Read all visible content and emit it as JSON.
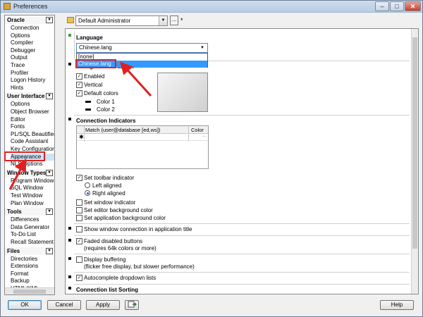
{
  "window": {
    "title": "Preferences",
    "min_glyph": "–",
    "max_glyph": "□",
    "close_glyph": "✕"
  },
  "nav": {
    "sections": [
      {
        "label": "Oracle",
        "collapse": "▾",
        "items": [
          "Connection",
          "Options",
          "Compiler",
          "Debugger",
          "Output",
          "Trace",
          "Profiler",
          "Logon History",
          "Hints"
        ]
      },
      {
        "label": "User Interface",
        "collapse": "▾",
        "items": [
          "Options",
          "Object Browser",
          "Editor",
          "Fonts",
          "PL/SQL Beautifier",
          "Code Assistant",
          "Key Configuration",
          "Appearance",
          "NLS Options"
        ]
      },
      {
        "label": "Window Types",
        "collapse": "▾",
        "items": [
          "Program Window",
          "SQL Window",
          "Test Window",
          "Plan Window"
        ]
      },
      {
        "label": "Tools",
        "collapse": "▾",
        "items": [
          "Differences",
          "Data Generator",
          "To-Do List",
          "Recall Statement"
        ]
      },
      {
        "label": "Files",
        "collapse": "▾",
        "items": [
          "Directories",
          "Extensions",
          "Format",
          "Backup",
          "HTML/XML"
        ]
      }
    ],
    "selected": "Appearance"
  },
  "toolbar": {
    "profile": "Default Administrator",
    "profile_arrow": "▼",
    "more_label": "...",
    "modified_marker": "*"
  },
  "language": {
    "title": "Language",
    "selected": "Chinese.lang",
    "arrow": "▼",
    "options": [
      "[none]",
      "Chinese.lang"
    ]
  },
  "gradient": {
    "title": "Background Gradient",
    "enabled_label": "Enabled",
    "vertical_label": "Vertical",
    "default_colors_label": "Default colors",
    "color1_label": "Color 1",
    "color2_label": "Color 2",
    "check_glyph": "✓"
  },
  "connection": {
    "title": "Connection Indicators",
    "columns": [
      "Match (user@database [ed,ws])",
      "Color"
    ],
    "new_row_marker": "✱",
    "cell_dots": "...",
    "toolbar_indicator_label": "Set toolbar indicator",
    "left_aligned_label": "Left aligned",
    "right_aligned_label": "Right aligned",
    "window_indicator_label": "Set window indicator",
    "editor_bg_label": "Set editor background color",
    "app_bg_label": "Set application background color"
  },
  "misc": {
    "show_window_conn_label": "Show window connection in application title",
    "faded_buttons_label": "Faded disabled buttons",
    "faded_buttons_note": "(requires 64k colors or more)",
    "display_buffering_label": "Display buffering",
    "display_buffering_note": "(flicker free display, but slower performance)",
    "autocomplete_label": "Autocomplete dropdown lists",
    "conn_list_sorting_title": "Connection list Sorting"
  },
  "buttons": {
    "ok": "OK",
    "cancel": "Cancel",
    "apply": "Apply",
    "help": "Help"
  },
  "colors": {
    "annotation_red": "#e02020",
    "selection_blue": "#3399ff",
    "marker_green": "#2fa23a"
  }
}
